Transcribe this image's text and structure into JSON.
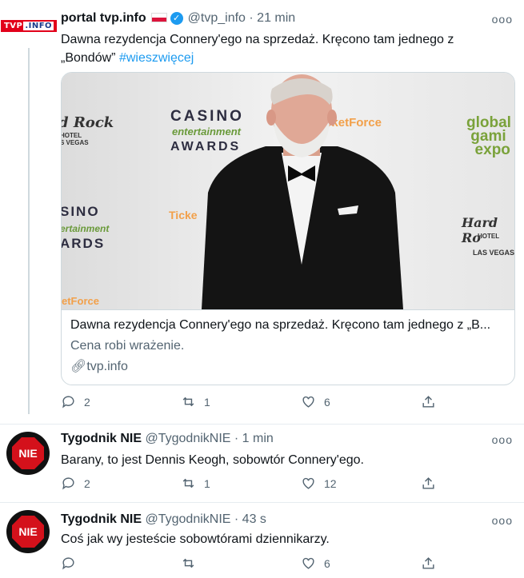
{
  "tweets": [
    {
      "name": "portal tvp.info",
      "handle": "@tvp_info",
      "time": "· 21 min",
      "text_line1": "Dawna rezydencja Connery'ego na sprzedaż. Kręcono tam jednego z",
      "text_line2": "„Bondów”",
      "hashtag": "#wieszwięcej",
      "avatar_text": "TVP.INFO",
      "card": {
        "title": "Dawna rezydencja Connery'ego na sprzedaż. Kręcono tam jednego z „B...",
        "description": "Cena robi wrażenie.",
        "domain": "tvp.info",
        "backdrop": [
          "Hard Rock HOTEL LAS VEGAS",
          "CASINO entertainment AWARDS",
          "TicketForce",
          "global gaming expo"
        ]
      },
      "replies": "2",
      "retweets": "1",
      "likes": "6"
    },
    {
      "name": "Tygodnik NIE",
      "handle": "@TygodnikNIE",
      "time": "· 1 min",
      "text": "Barany, to jest Dennis Keogh, sobowtór Connery'ego.",
      "avatar_text": "NIE",
      "replies": "2",
      "retweets": "1",
      "likes": "12"
    },
    {
      "name": "Tygodnik NIE",
      "handle": "@TygodnikNIE",
      "time": "· 43 s",
      "text": "Coś jak wy jesteście sobowtórami dziennikarzy.",
      "avatar_text": "NIE",
      "replies": "",
      "retweets": "",
      "likes": "6"
    }
  ],
  "more_label": "ooo",
  "colors": {
    "accent": "#1d9bf0",
    "muted": "#536471",
    "nie_red": "#d4111b",
    "tvp_red": "#e2001a"
  }
}
